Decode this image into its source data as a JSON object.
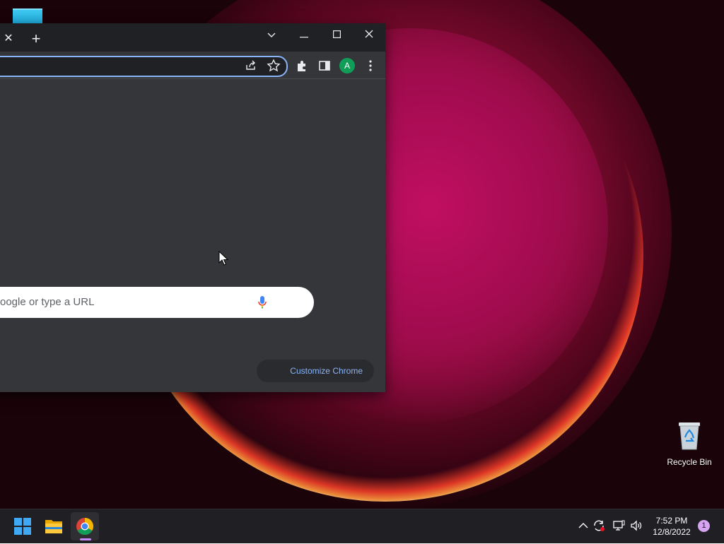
{
  "desktop": {
    "recycle_bin_label": "Recycle Bin"
  },
  "chrome": {
    "tab_close_glyph": "✕",
    "new_tab_glyph": "+",
    "window_controls": {
      "tab_search": "⌄",
      "minimize": "—",
      "maximize": "☐",
      "close": "✕"
    },
    "avatar_initial": "A",
    "ntp_search_placeholder": "oogle or type a URL",
    "customize_label": "Customize Chrome"
  },
  "taskbar": {
    "time": "7:52 PM",
    "date": "12/8/2022",
    "notification_count": "1"
  },
  "icons": [
    "windows-start-icon",
    "file-explorer-icon",
    "chrome-icon",
    "chevron-up-icon",
    "sync-icon",
    "network-icon",
    "volume-icon",
    "share-icon",
    "star-icon",
    "extensions-icon",
    "side-panel-icon",
    "more-menu-icon",
    "mic-icon",
    "recycle-bin-icon"
  ],
  "colors": {
    "accent": "#8ab4f8",
    "chrome_bg": "#35363a",
    "taskbar_bg": "#1f1f24"
  }
}
